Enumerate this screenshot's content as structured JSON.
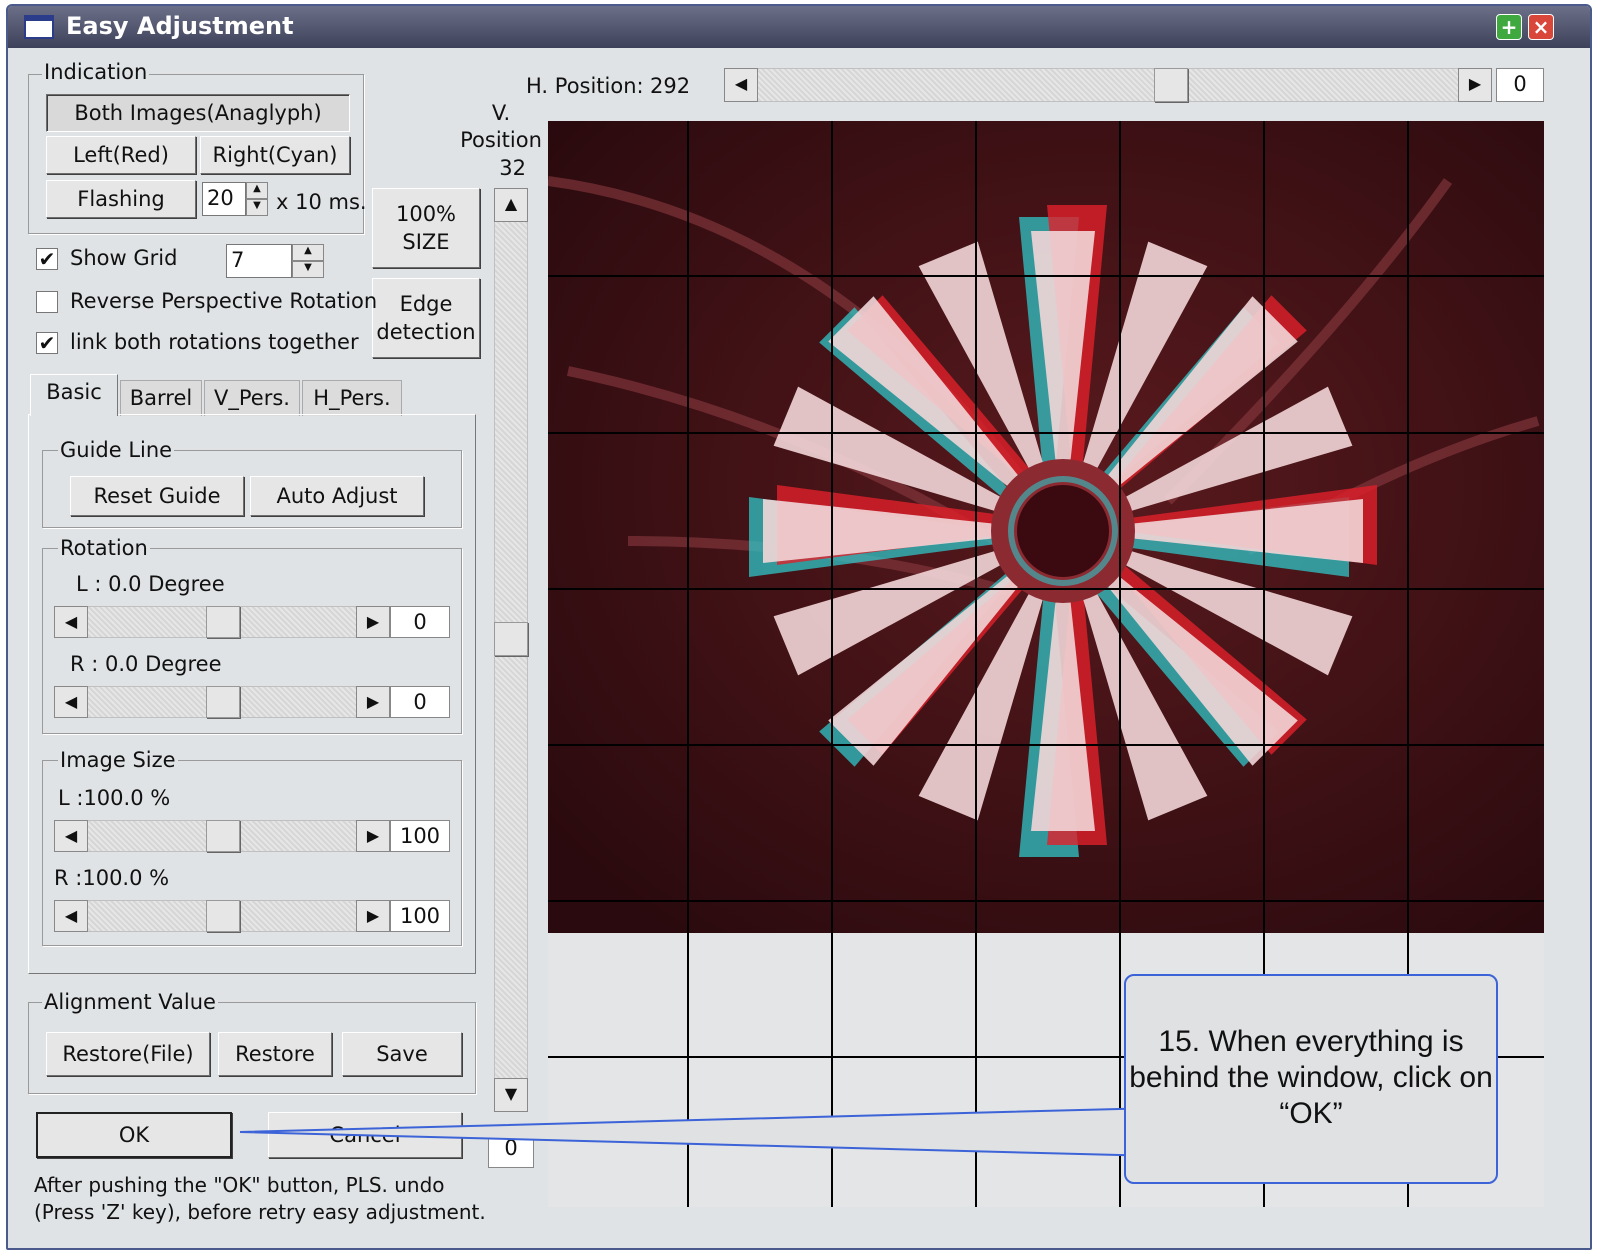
{
  "window": {
    "title": "Easy Adjustment"
  },
  "indication": {
    "label": "Indication",
    "both_images": "Both Images(Anaglyph)",
    "left_red": "Left(Red)",
    "right_cyan": "Right(Cyan)",
    "flashing": "Flashing",
    "flash_interval": "20",
    "flash_unit": "x 10 ms."
  },
  "size_button": "100%\nSIZE",
  "edge_button": "Edge\ndetection",
  "options": {
    "show_grid": "Show Grid",
    "grid_value": "7",
    "reverse_perspective": "Reverse Perspective Rotation",
    "link_rotations": "link both rotations together"
  },
  "tabs": [
    "Basic",
    "Barrel",
    "V_Pers.",
    "H_Pers."
  ],
  "guide_line": {
    "label": "Guide Line",
    "reset": "Reset Guide",
    "auto": "Auto Adjust"
  },
  "rotation": {
    "label": "Rotation",
    "left": "L : 0.0 Degree",
    "left_value": "0",
    "right": "R : 0.0 Degree",
    "right_value": "0"
  },
  "image_size": {
    "label": "Image Size",
    "left": "L :100.0 %",
    "left_value": "100",
    "right": "R :100.0 %",
    "right_value": "100"
  },
  "alignment": {
    "label": "Alignment Value",
    "restore_file": "Restore(File)",
    "restore": "Restore",
    "save": "Save"
  },
  "buttons": {
    "ok": "OK",
    "cancel": "Cancel"
  },
  "note": "After pushing the \"OK\" button, PLS. undo\n(Press 'Z' key), before retry easy adjustment.",
  "h_position": {
    "label": "H. Position:",
    "value": "292",
    "box": "0"
  },
  "v_position": {
    "label": "V.\nPosition",
    "value": "32",
    "box": "0"
  },
  "callout": "15. When everything is behind the window, click on “OK”",
  "colors": {
    "title_bar": "#4e536b",
    "callout_border": "#3c63d8",
    "anaglyph_red": "#e0202a",
    "anaglyph_cyan": "#2fc6c8"
  }
}
